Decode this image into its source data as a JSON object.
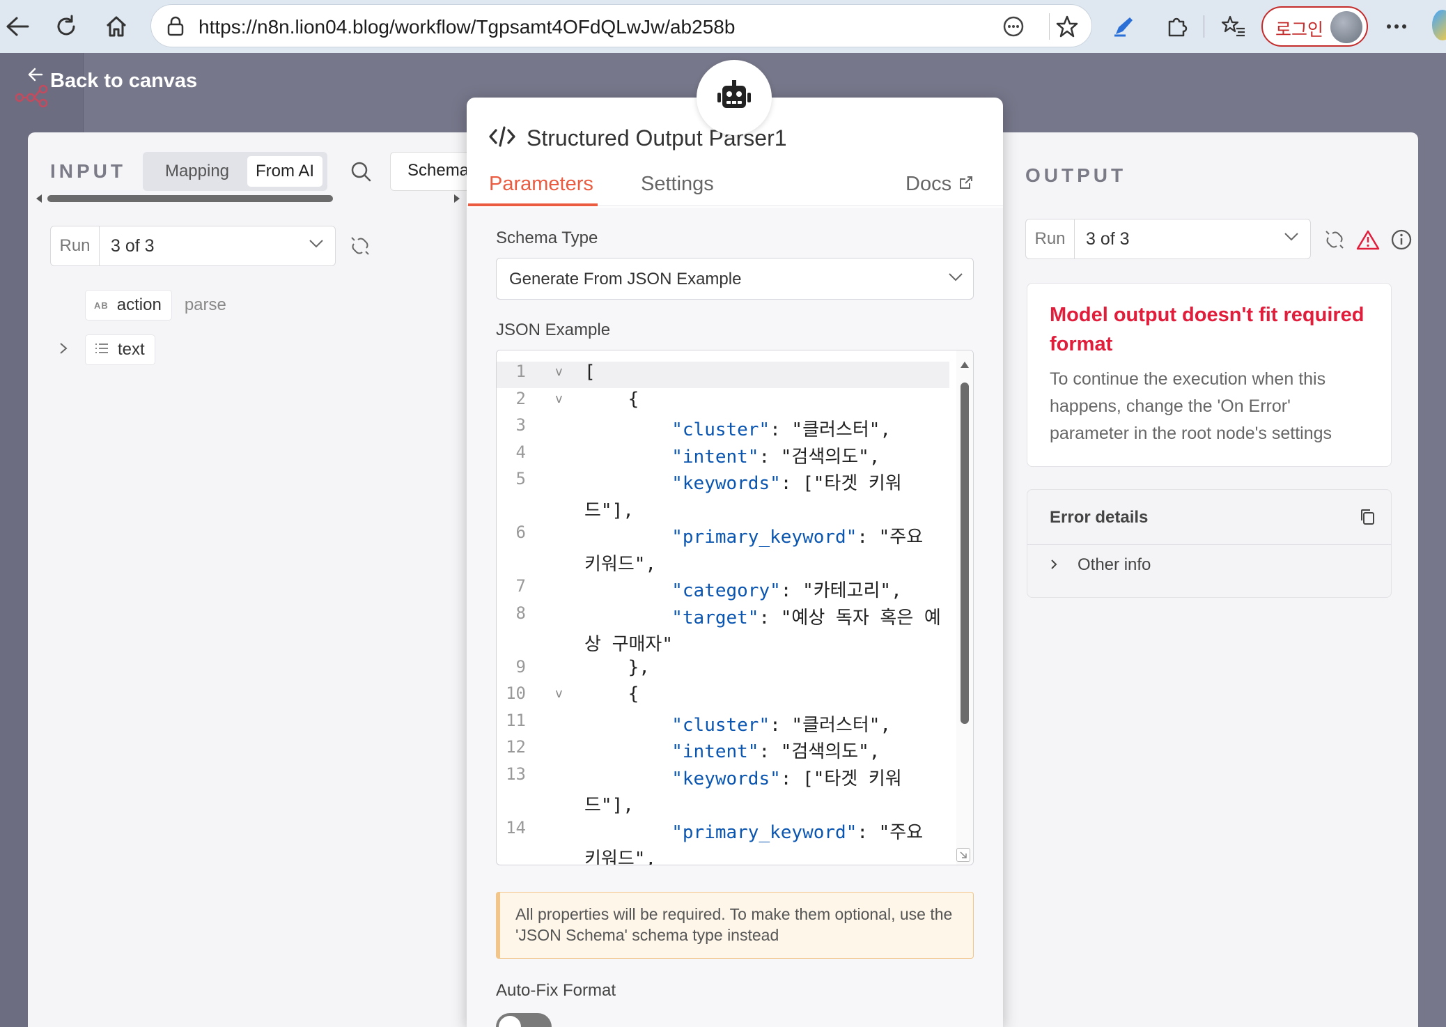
{
  "browser": {
    "url": "https://n8n.lion04.blog/workflow/Tgpsamt4OFdQLwJw/ab258b",
    "login_label": "로그인"
  },
  "canvas": {
    "back_label": "Back to canvas"
  },
  "input_panel": {
    "title": "INPUT",
    "modes": [
      "Mapping",
      "From AI"
    ],
    "schema_tab": "Schema",
    "run_label": "Run",
    "run_value": "3 of 3",
    "fields": [
      {
        "type": "AB",
        "name": "action",
        "value": "parse"
      },
      {
        "type": "list",
        "name": "text",
        "value": ""
      }
    ]
  },
  "node": {
    "icon": "robot-icon",
    "title": "Structured Output Parser1",
    "tabs": {
      "parameters": "Parameters",
      "settings": "Settings",
      "docs": "Docs"
    },
    "schema_type_label": "Schema Type",
    "schema_type_value": "Generate From JSON Example",
    "json_example_label": "JSON Example",
    "code_lines": [
      {
        "n": "1",
        "fold": "v",
        "code": "["
      },
      {
        "n": "2",
        "fold": "v",
        "code": "    {"
      },
      {
        "n": "3",
        "fold": "",
        "key": "\"cluster\"",
        "rest": ": \"클러스터\","
      },
      {
        "n": "4",
        "fold": "",
        "key": "\"intent\"",
        "rest": ": \"검색의도\","
      },
      {
        "n": "5",
        "fold": "",
        "key": "\"keywords\"",
        "rest": ": [\"타겟 키워",
        "wrap": "드\"],"
      },
      {
        "n": "6",
        "fold": "",
        "key": "\"primary_keyword\"",
        "rest": ": \"주요",
        "wrap": "키워드\","
      },
      {
        "n": "7",
        "fold": "",
        "key": "\"category\"",
        "rest": ": \"카테고리\","
      },
      {
        "n": "8",
        "fold": "",
        "key": "\"target\"",
        "rest": ": \"예상 독자 혹은 예",
        "wrap": "상 구매자\""
      },
      {
        "n": "9",
        "fold": "",
        "code": "    },"
      },
      {
        "n": "10",
        "fold": "v",
        "code": "    {"
      },
      {
        "n": "11",
        "fold": "",
        "key": "\"cluster\"",
        "rest": ": \"클러스터\","
      },
      {
        "n": "12",
        "fold": "",
        "key": "\"intent\"",
        "rest": ": \"검색의도\","
      },
      {
        "n": "13",
        "fold": "",
        "key": "\"keywords\"",
        "rest": ": [\"타겟 키워",
        "wrap": "드\"],"
      },
      {
        "n": "14",
        "fold": "",
        "key": "\"primary_keyword\"",
        "rest": ": \"주요",
        "wrap": "키워드\","
      }
    ],
    "notice": "All properties will be required. To make them optional, use the 'JSON Schema' schema type instead",
    "autofix_label": "Auto-Fix Format",
    "autofix_on": false
  },
  "output_panel": {
    "title": "OUTPUT",
    "run_label": "Run",
    "run_value": "3 of 3",
    "error_title": "Model output doesn't fit required format",
    "error_desc": "To continue the execution when this happens, change the 'On Error' parameter in the root node's settings",
    "details_label": "Error details",
    "other_info_label": "Other info"
  },
  "colors": {
    "accent": "#ea5b40",
    "error": "#e01e3c",
    "json_key": "#0a55b0"
  }
}
